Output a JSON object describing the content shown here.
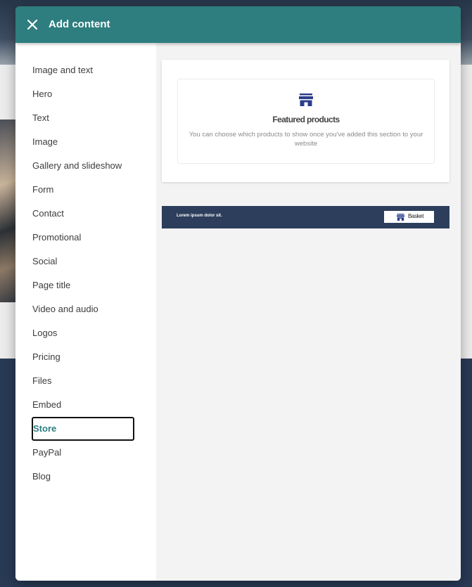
{
  "modal": {
    "title": "Add content",
    "close_icon": "close-icon"
  },
  "sidebar": {
    "items": [
      {
        "label": "Image and text"
      },
      {
        "label": "Hero"
      },
      {
        "label": "Text"
      },
      {
        "label": "Image"
      },
      {
        "label": "Gallery and slideshow"
      },
      {
        "label": "Form"
      },
      {
        "label": "Contact"
      },
      {
        "label": "Promotional"
      },
      {
        "label": "Social"
      },
      {
        "label": "Page title"
      },
      {
        "label": "Video and audio"
      },
      {
        "label": "Logos"
      },
      {
        "label": "Pricing"
      },
      {
        "label": "Files"
      },
      {
        "label": "Embed"
      },
      {
        "label": "Store",
        "selected": true
      },
      {
        "label": "PayPal"
      },
      {
        "label": "Blog"
      }
    ]
  },
  "store_sections": {
    "featured_products": {
      "icon": "store-icon",
      "title": "Featured products",
      "description": "You can choose which products to show once you've added this section to your website"
    },
    "basket_bar": {
      "text": "Lorem ipsum dolor sit.",
      "button_label": "Basket",
      "button_icon": "store-icon"
    }
  },
  "colors": {
    "header": "#2e7d7f",
    "selected_text": "#2e7d7f",
    "basket_bar": "#2c3e5c",
    "icon": "#2c3e8c"
  }
}
